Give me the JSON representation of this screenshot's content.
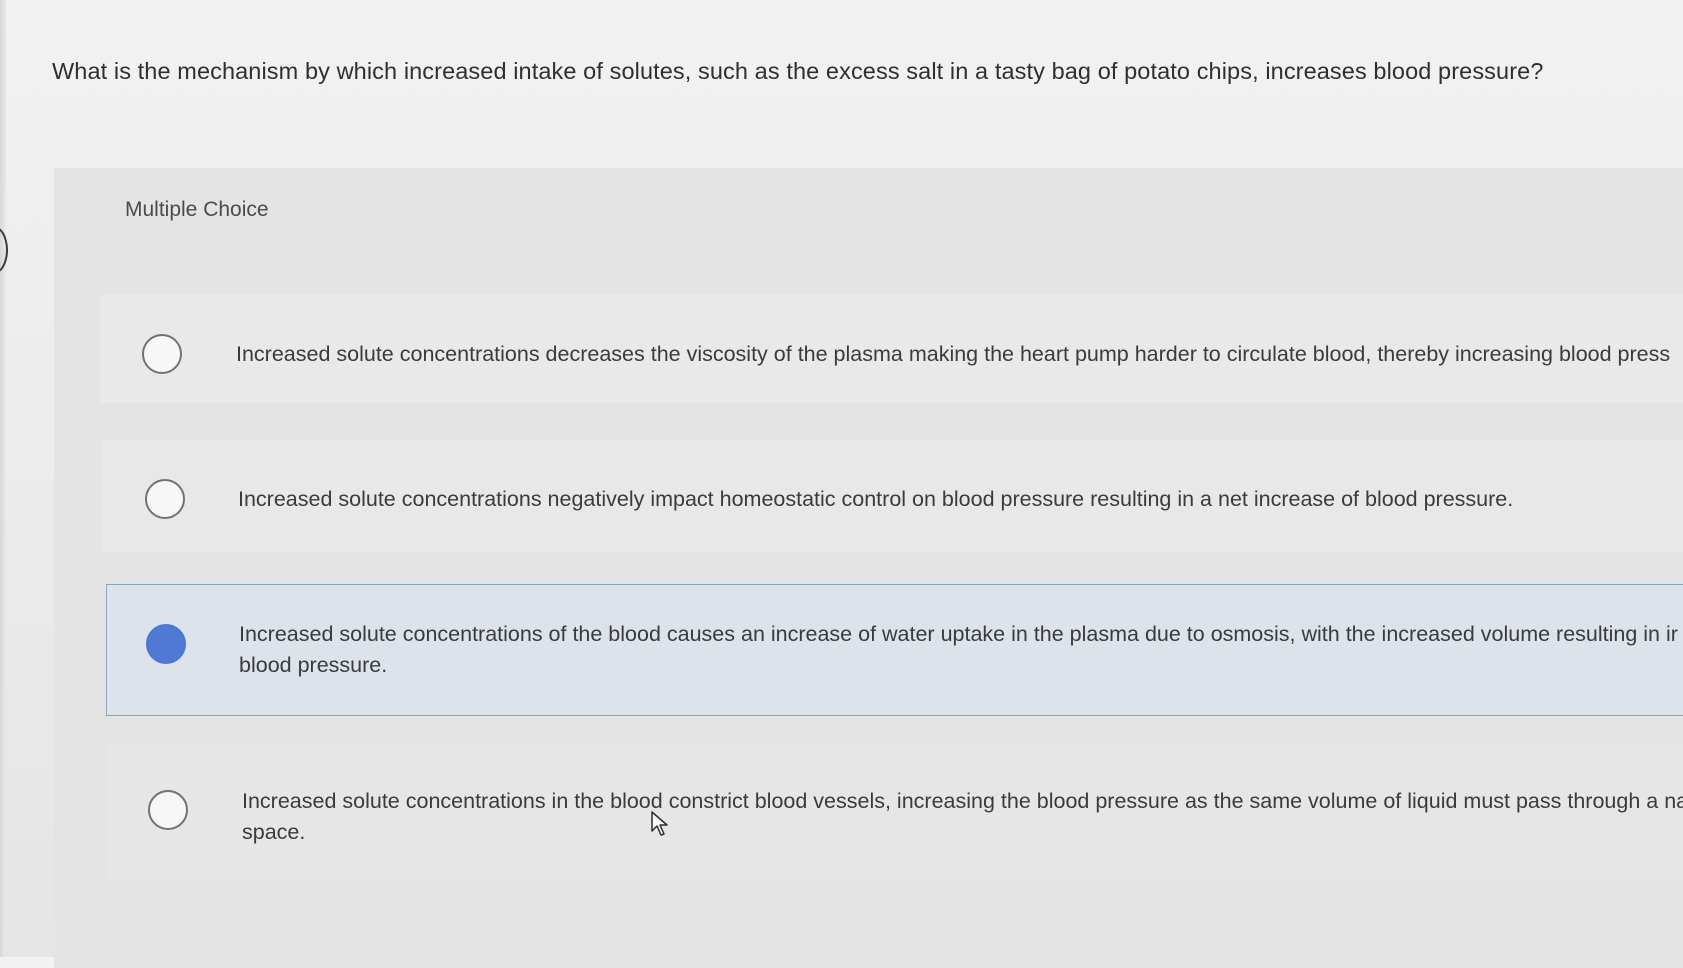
{
  "question": {
    "text": "What is the mechanism by which increased intake of solutes, such as the excess salt in a tasty bag of potato chips, increases blood pressure?"
  },
  "multiple_choice": {
    "label": "Multiple Choice",
    "options": [
      {
        "line1": "Increased solute concentrations decreases the viscosity of the plasma making the heart pump harder to circulate blood, thereby increasing blood press",
        "line2": "",
        "selected": false
      },
      {
        "line1": "Increased solute concentrations negatively impact homeostatic control on blood pressure resulting in a net increase of blood pressure.",
        "line2": "",
        "selected": false
      },
      {
        "line1": "Increased solute concentrations of the blood causes an increase of water uptake in the plasma due to osmosis, with the increased volume resulting in ir",
        "line2": "blood pressure.",
        "selected": true
      },
      {
        "line1": "Increased solute concentrations in the blood constrict blood vessels, increasing the blood pressure as the same volume of liquid must pass through a na",
        "line2": "space.",
        "selected": false
      }
    ]
  },
  "colors": {
    "selected_radio": "#4f79d2",
    "selected_option_border": "#8ea2bb"
  },
  "icons": {
    "cursor": "mouse-pointer-icon"
  }
}
